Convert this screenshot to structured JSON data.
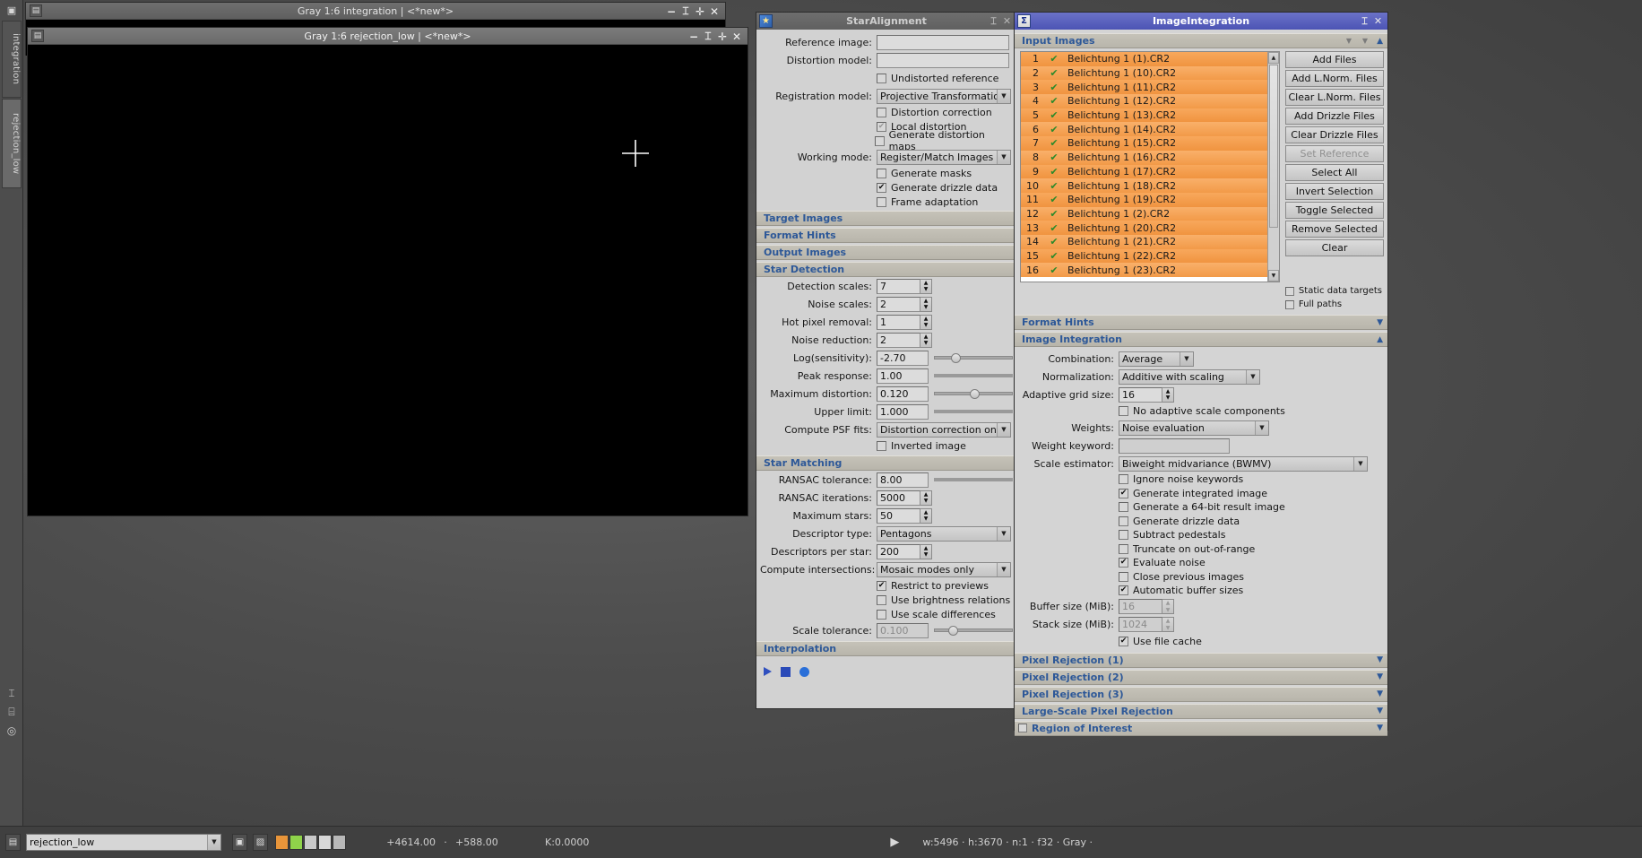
{
  "image_windows": [
    {
      "title": "Gray 1:6 integration | <*new*>",
      "icon": "image-icon",
      "buttons": [
        "minimize",
        "maximize",
        "restore",
        "close"
      ]
    },
    {
      "title": "Gray 1:6 rejection_low | <*new*>",
      "icon": "image-icon",
      "buttons": [
        "minimize",
        "maximize",
        "restore",
        "close"
      ]
    }
  ],
  "left_rail": {
    "top_icon": "panel-icon",
    "tabs": [
      "integration",
      "rejection_low"
    ],
    "bottom_icons": [
      "histogram-icon",
      "curves-icon",
      "target-icon"
    ]
  },
  "star_alignment": {
    "title": "StarAlignment",
    "icon": "star-align-icon",
    "window_buttons": [
      "minimize",
      "close"
    ],
    "fields": {
      "reference_image_label": "Reference image:",
      "reference_image_value": "",
      "distortion_model_label": "Distortion model:",
      "distortion_model_value": "",
      "undistorted_reference": "Undistorted reference",
      "registration_model_label": "Registration model:",
      "registration_model_value": "Projective Transformation",
      "distortion_correction": "Distortion correction",
      "local_distortion": "Local distortion",
      "generate_distortion_maps": "Generate distortion maps",
      "working_mode_label": "Working mode:",
      "working_mode_value": "Register/Match Images",
      "generate_masks": "Generate masks",
      "generate_drizzle_data": "Generate drizzle data",
      "frame_adaptation": "Frame adaptation"
    },
    "sections": {
      "target_images": "Target Images",
      "format_hints": "Format Hints",
      "output_images": "Output Images",
      "star_detection": "Star Detection",
      "star_matching": "Star Matching",
      "interpolation": "Interpolation"
    },
    "star_detection": [
      {
        "label": "Detection scales:",
        "value": "7",
        "type": "spin"
      },
      {
        "label": "Noise scales:",
        "value": "2",
        "type": "spin"
      },
      {
        "label": "Hot pixel removal:",
        "value": "1",
        "type": "spin"
      },
      {
        "label": "Noise reduction:",
        "value": "2",
        "type": "spin"
      },
      {
        "label": "Log(sensitivity):",
        "value": "-2.70",
        "type": "slider",
        "pos": 22
      },
      {
        "label": "Peak response:",
        "value": "1.00",
        "type": "slider",
        "pos": 100
      },
      {
        "label": "Maximum distortion:",
        "value": "0.120",
        "type": "slider",
        "pos": 46
      },
      {
        "label": "Upper limit:",
        "value": "1.000",
        "type": "slider",
        "pos": 100
      }
    ],
    "compute_psf_label": "Compute PSF fits:",
    "compute_psf_value": "Distortion correction only",
    "inverted_image": "Inverted image",
    "star_matching": [
      {
        "label": "RANSAC tolerance:",
        "value": "8.00",
        "type": "slider",
        "pos": 100
      },
      {
        "label": "RANSAC iterations:",
        "value": "5000",
        "type": "spin"
      },
      {
        "label": "Maximum stars:",
        "value": "50",
        "type": "spin"
      }
    ],
    "descriptor_type_label": "Descriptor type:",
    "descriptor_type_value": "Pentagons",
    "descriptors_per_star_label": "Descriptors per star:",
    "descriptors_per_star_value": "200",
    "compute_intersections_label": "Compute intersections:",
    "compute_intersections_value": "Mosaic modes only",
    "restrict_to_previews": "Restrict to previews",
    "use_brightness_relations": "Use brightness relations",
    "use_scale_differences": "Use scale differences",
    "scale_tolerance_label": "Scale tolerance:",
    "scale_tolerance_value": "0.100"
  },
  "image_integration": {
    "title": "ImageIntegration",
    "icon": "sigma-icon",
    "window_buttons": [
      "minimize",
      "close"
    ],
    "sections": {
      "input_images": "Input Images",
      "format_hints": "Format Hints",
      "image_integration": "Image Integration",
      "pixel_rejection_1": "Pixel Rejection (1)",
      "pixel_rejection_2": "Pixel Rejection (2)",
      "pixel_rejection_3": "Pixel Rejection (3)",
      "large_scale_pixel_rejection": "Large-Scale Pixel Rejection",
      "region_of_interest": "Region of Interest"
    },
    "file_list": [
      {
        "n": "1",
        "name": "Belichtung 1 (1).CR2",
        "checked": true
      },
      {
        "n": "2",
        "name": "Belichtung 1 (10).CR2",
        "checked": true
      },
      {
        "n": "3",
        "name": "Belichtung 1 (11).CR2",
        "checked": true
      },
      {
        "n": "4",
        "name": "Belichtung 1 (12).CR2",
        "checked": true
      },
      {
        "n": "5",
        "name": "Belichtung 1 (13).CR2",
        "checked": true
      },
      {
        "n": "6",
        "name": "Belichtung 1 (14).CR2",
        "checked": true
      },
      {
        "n": "7",
        "name": "Belichtung 1 (15).CR2",
        "checked": true
      },
      {
        "n": "8",
        "name": "Belichtung 1 (16).CR2",
        "checked": true
      },
      {
        "n": "9",
        "name": "Belichtung 1 (17).CR2",
        "checked": true
      },
      {
        "n": "10",
        "name": "Belichtung 1 (18).CR2",
        "checked": true
      },
      {
        "n": "11",
        "name": "Belichtung 1 (19).CR2",
        "checked": true
      },
      {
        "n": "12",
        "name": "Belichtung 1 (2).CR2",
        "checked": true
      },
      {
        "n": "13",
        "name": "Belichtung 1 (20).CR2",
        "checked": true
      },
      {
        "n": "14",
        "name": "Belichtung 1 (21).CR2",
        "checked": true
      },
      {
        "n": "15",
        "name": "Belichtung 1 (22).CR2",
        "checked": true
      },
      {
        "n": "16",
        "name": "Belichtung 1 (23).CR2",
        "checked": true
      }
    ],
    "side_buttons": [
      {
        "label": "Add Files",
        "enabled": true
      },
      {
        "label": "Add L.Norm. Files",
        "enabled": true
      },
      {
        "label": "Clear L.Norm. Files",
        "enabled": true
      },
      {
        "label": "Add Drizzle Files",
        "enabled": true
      },
      {
        "label": "Clear Drizzle Files",
        "enabled": true
      },
      {
        "label": "Set Reference",
        "enabled": false
      },
      {
        "label": "Select All",
        "enabled": true
      },
      {
        "label": "Invert Selection",
        "enabled": true
      },
      {
        "label": "Toggle Selected",
        "enabled": true
      },
      {
        "label": "Remove Selected",
        "enabled": true
      },
      {
        "label": "Clear",
        "enabled": true
      }
    ],
    "static_data_targets": "Static data targets",
    "full_paths": "Full paths",
    "settings": {
      "combination_label": "Combination:",
      "combination_value": "Average",
      "normalization_label": "Normalization:",
      "normalization_value": "Additive with scaling",
      "adaptive_grid_size_label": "Adaptive grid size:",
      "adaptive_grid_size_value": "16",
      "no_adaptive_scale_components": "No adaptive scale components",
      "weights_label": "Weights:",
      "weights_value": "Noise evaluation",
      "weight_keyword_label": "Weight keyword:",
      "weight_keyword_value": "",
      "scale_estimator_label": "Scale estimator:",
      "scale_estimator_value": "Biweight midvariance (BWMV)",
      "buffer_size_label": "Buffer size (MiB):",
      "buffer_size_value": "16",
      "stack_size_label": "Stack size (MiB):",
      "stack_size_value": "1024"
    },
    "checkboxes": [
      {
        "label": "Ignore noise keywords",
        "checked": false
      },
      {
        "label": "Generate integrated image",
        "checked": true
      },
      {
        "label": "Generate a 64-bit result image",
        "checked": false
      },
      {
        "label": "Generate drizzle data",
        "checked": false
      },
      {
        "label": "Subtract pedestals",
        "checked": false
      },
      {
        "label": "Truncate on out-of-range",
        "checked": false
      },
      {
        "label": "Evaluate noise",
        "checked": true
      },
      {
        "label": "Close previous images",
        "checked": false
      },
      {
        "label": "Automatic buffer sizes",
        "checked": true
      }
    ],
    "use_file_cache": "Use file cache"
  },
  "status_bar": {
    "view_selector": "rejection_low",
    "coord_x": "+4614.00",
    "coord_sep": "·",
    "coord_y": "+588.00",
    "k_value": "K:0.0000",
    "play_icon": "play-icon",
    "info": "w:5496 · h:3670 · n:1 · f32 · Gray ·",
    "swatches": [
      "#e8953a",
      "#8fd34a",
      "#c9c9c9",
      "#d8d8d8",
      "#b8b8b8"
    ]
  }
}
